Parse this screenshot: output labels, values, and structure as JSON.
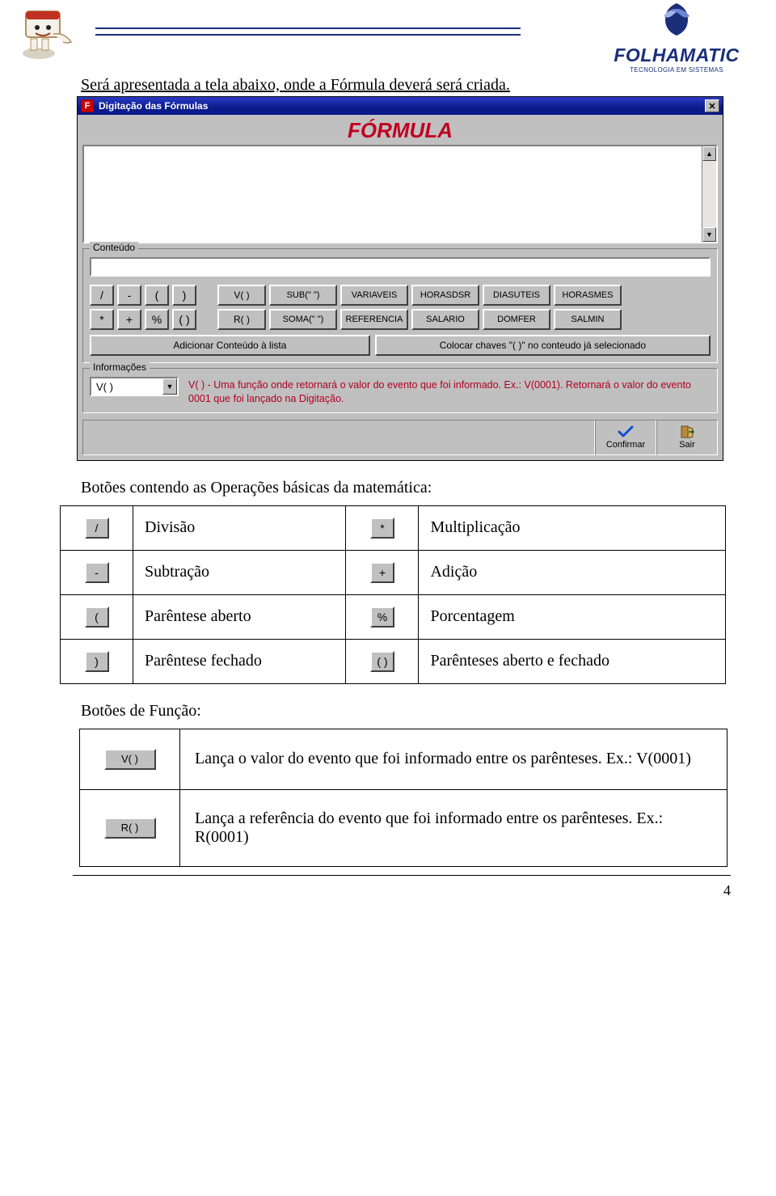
{
  "brand": {
    "name": "FOLHAMATIC",
    "sub": "TECNOLOGIA EM SISTEMAS"
  },
  "intro": "Será apresentada a tela abaixo, onde a Fórmula deverá será criada.",
  "window": {
    "title": "Digitação das Fórmulas",
    "header": "FÓRMULA",
    "groups": {
      "conteudo": "Conteúdo",
      "informacoes": "Informações"
    },
    "buttons": {
      "row1": [
        "/",
        "-",
        "(",
        ")"
      ],
      "row2": [
        "*",
        "+",
        "%",
        "( )"
      ],
      "fn1": [
        "V(  )",
        "SUB(\" \")",
        "VARIAVEIS",
        "HORASDSR",
        "DIASUTEIS",
        "HORASMES"
      ],
      "fn2": [
        "R(  )",
        "SOMA(\" \")",
        "REFERENCIA",
        "SALARIO",
        "DOMFER",
        "SALMIN"
      ],
      "wide1": "Adicionar Conteúdo à lista",
      "wide2": "Colocar chaves \"( )\" no conteudo já selecionado"
    },
    "info": {
      "dropdown": "V(  )",
      "text": "V(  ) - Uma função onde retornará o valor do evento que foi informado. Ex.: V(0001). Retornará o valor do evento 0001 que foi lançado na Digitação."
    },
    "footer": {
      "confirm": "Confirmar",
      "exit": "Sair"
    }
  },
  "explain": {
    "ops_header": "Botões contendo as Operações básicas da matemática:",
    "ops": [
      {
        "sym1": "/",
        "lbl1": "Divisão",
        "sym2": "*",
        "lbl2": "Multiplicação"
      },
      {
        "sym1": "-",
        "lbl1": "Subtração",
        "sym2": "+",
        "lbl2": "Adição"
      },
      {
        "sym1": "(",
        "lbl1": "Parêntese aberto",
        "sym2": "%",
        "lbl2": "Porcentagem"
      },
      {
        "sym1": ")",
        "lbl1": "Parêntese fechado",
        "sym2": "( )",
        "lbl2": "Parênteses aberto e fechado"
      }
    ],
    "fn_header": "Botões de Função:",
    "fns": [
      {
        "btn": "V(  )",
        "desc": "Lança o valor do evento que foi informado entre os parênteses. Ex.: V(0001)"
      },
      {
        "btn": "R(  )",
        "desc": "Lança a referência do evento que foi informado entre os parênteses. Ex.: R(0001)"
      }
    ]
  },
  "page_number": "4"
}
